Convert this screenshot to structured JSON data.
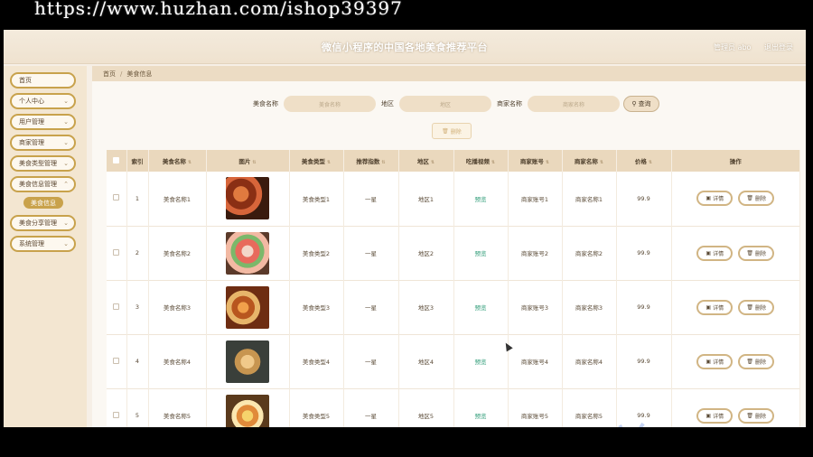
{
  "watermark": "https://www.huzhan.com/ishop39397",
  "header": {
    "title": "微信小程序的中国各地美食推荐平台",
    "user_label": "管理员 abo",
    "logout_label": "退出登录"
  },
  "sidebar": {
    "items": [
      {
        "label": "首页"
      },
      {
        "label": "个人中心"
      },
      {
        "label": "用户管理"
      },
      {
        "label": "商家管理"
      },
      {
        "label": "美食类型管理"
      },
      {
        "label": "美食信息管理"
      },
      {
        "label": "美食分享管理"
      },
      {
        "label": "系统管理"
      }
    ],
    "active_sub": "美食信息"
  },
  "breadcrumb": {
    "home": "首页",
    "sep": "/",
    "current": "美食信息"
  },
  "search": {
    "name_label": "美食名称",
    "name_placeholder": "美食名称",
    "region_label": "地区",
    "region_placeholder": "地区",
    "merchant_label": "商家名称",
    "merchant_placeholder": "商家名称",
    "button_label": "查询"
  },
  "delete_button": "删除",
  "table": {
    "headers": [
      "索引",
      "美食名称",
      "图片",
      "美食类型",
      "推荐指数",
      "地区",
      "吃播视频",
      "商家账号",
      "商家名称",
      "价格",
      "操作"
    ],
    "rows": [
      {
        "index": "1",
        "name": "美食名称1",
        "type": "美食类型1",
        "rating": "一星",
        "region": "地区1",
        "video": "预览",
        "account": "商家账号1",
        "merchant": "商家名称1",
        "price": "99.9"
      },
      {
        "index": "2",
        "name": "美食名称2",
        "type": "美食类型2",
        "rating": "一星",
        "region": "地区2",
        "video": "预览",
        "account": "商家账号2",
        "merchant": "商家名称2",
        "price": "99.9"
      },
      {
        "index": "3",
        "name": "美食名称3",
        "type": "美食类型3",
        "rating": "一星",
        "region": "地区3",
        "video": "预览",
        "account": "商家账号3",
        "merchant": "商家名称3",
        "price": "99.9"
      },
      {
        "index": "4",
        "name": "美食名称4",
        "type": "美食类型4",
        "rating": "一星",
        "region": "地区4",
        "video": "预览",
        "account": "商家账号4",
        "merchant": "商家名称4",
        "price": "99.9"
      },
      {
        "index": "5",
        "name": "美食名称5",
        "type": "美食类型5",
        "rating": "一星",
        "region": "地区5",
        "video": "预览",
        "account": "商家账号5",
        "merchant": "商家名称5",
        "price": "99.9"
      }
    ],
    "detail_label": "详情",
    "delete_label": "删除"
  },
  "colors": {
    "accent": "#c9a24b",
    "header_bg": "#ead8bd",
    "video_link": "#2f9c78"
  }
}
